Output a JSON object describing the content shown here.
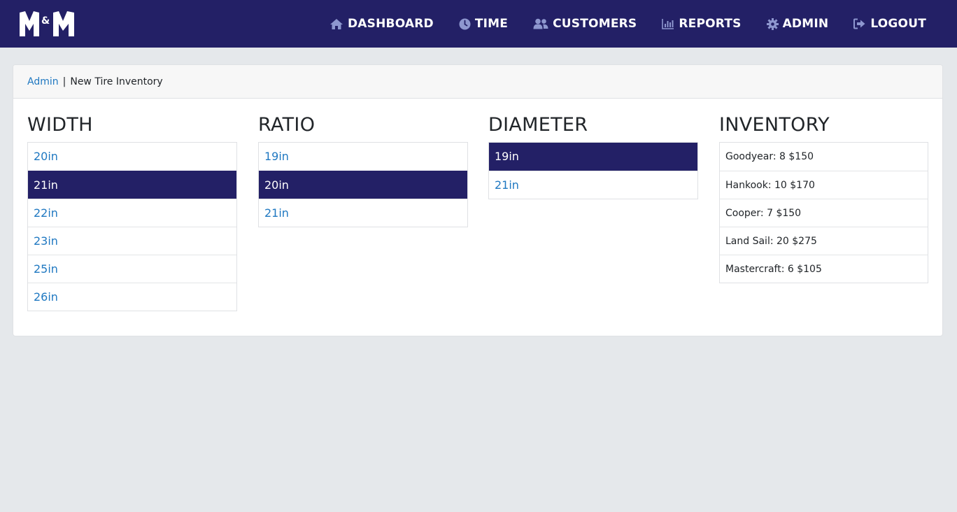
{
  "nav": {
    "logo_alt": "M&M",
    "items": [
      {
        "label": "DASHBOARD",
        "icon": "home-icon"
      },
      {
        "label": "TIME",
        "icon": "clock-icon"
      },
      {
        "label": "CUSTOMERS",
        "icon": "users-icon"
      },
      {
        "label": "REPORTS",
        "icon": "chart-icon"
      },
      {
        "label": "ADMIN",
        "icon": "gear-icon"
      },
      {
        "label": "LOGOUT",
        "icon": "logout-icon"
      }
    ]
  },
  "breadcrumb": {
    "link": "Admin",
    "separator": "|",
    "current": "New Tire Inventory"
  },
  "width": {
    "heading": "WIDTH",
    "items": [
      "20in",
      "21in",
      "22in",
      "23in",
      "25in",
      "26in"
    ],
    "selected": "21in"
  },
  "ratio": {
    "heading": "RATIO",
    "items": [
      "19in",
      "20in",
      "21in"
    ],
    "selected": "20in"
  },
  "diameter": {
    "heading": "DIAMETER",
    "items": [
      "19in",
      "21in"
    ],
    "selected": "19in"
  },
  "inventory": {
    "heading": "INVENTORY",
    "items": [
      "Goodyear: 8 $150",
      "Hankook: 10 $170",
      "Cooper: 7 $150",
      "Land Sail: 20 $275",
      "Mastercraft: 6 $105"
    ]
  },
  "colors": {
    "brand": "#232066",
    "link": "#1f78c1",
    "background": "#e5e8eb"
  }
}
